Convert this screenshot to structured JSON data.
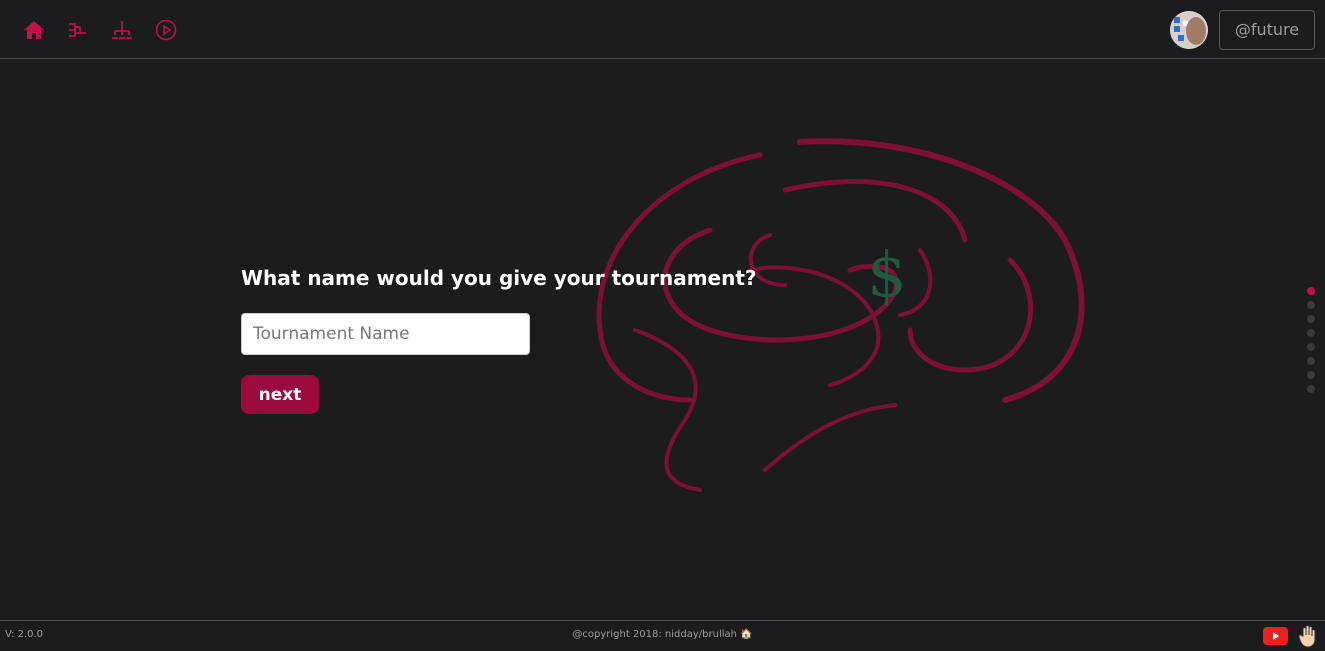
{
  "header": {
    "nav": [
      {
        "name": "home-icon"
      },
      {
        "name": "bracket-icon"
      },
      {
        "name": "hierarchy-icon"
      },
      {
        "name": "play-icon"
      }
    ],
    "user_label": "@future",
    "avatar_icon": "avatar"
  },
  "main": {
    "question": "What name would you give your tournament?",
    "input": {
      "placeholder": "Tournament Name",
      "value": ""
    },
    "next_label": "next",
    "background_icon": "brain-dollar-icon"
  },
  "pager": {
    "count": 8,
    "active_index": 0
  },
  "footer": {
    "version": "V: 2.0.0",
    "copyright": "@copyright 2018: nidday/brullah 🏠"
  },
  "colors": {
    "accent": "#9a0a3c",
    "brain": "#7d1035",
    "dollar": "#1e5a3f",
    "background": "#1c1b1d"
  }
}
